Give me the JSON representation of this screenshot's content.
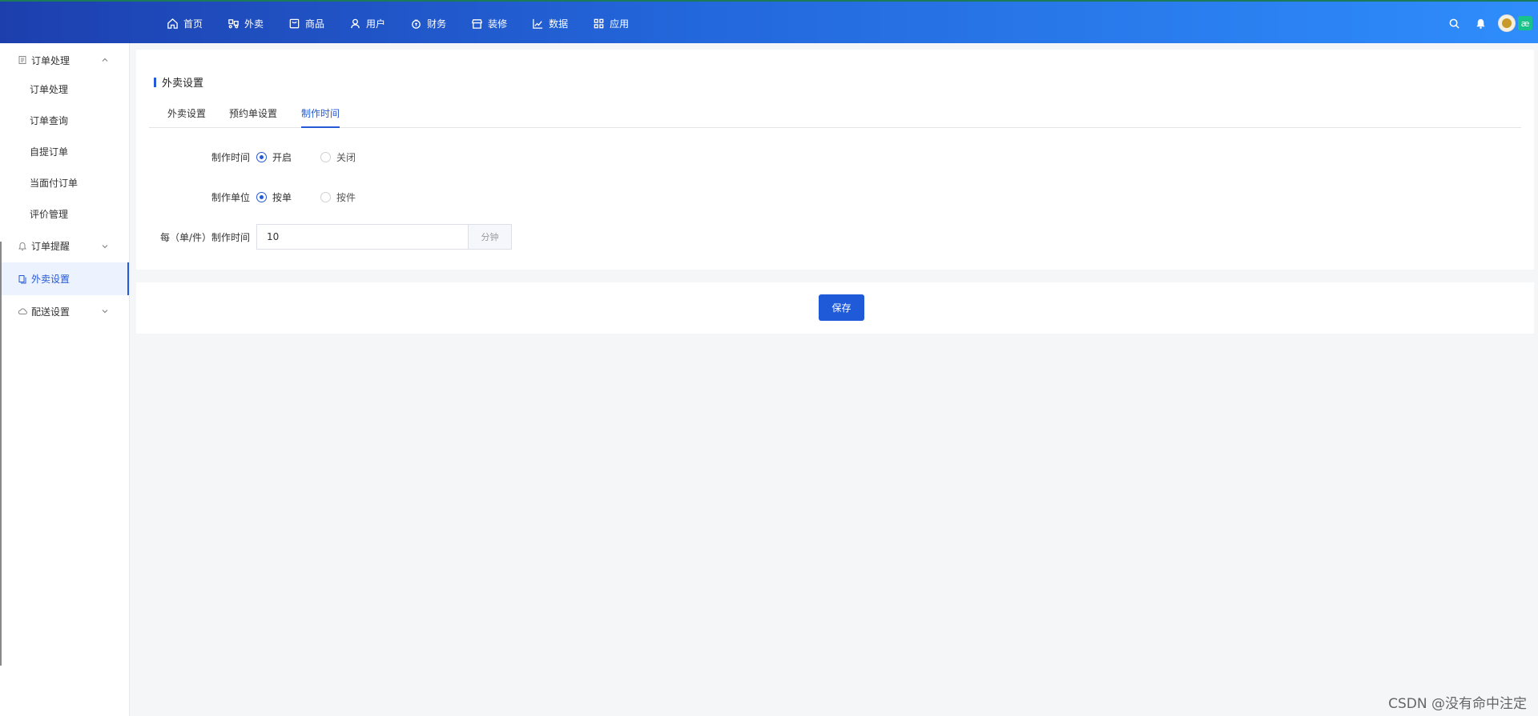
{
  "header": {
    "nav": [
      {
        "label": "首页",
        "icon": "home-icon"
      },
      {
        "label": "外卖",
        "icon": "delivery-icon"
      },
      {
        "label": "商品",
        "icon": "product-icon"
      },
      {
        "label": "用户",
        "icon": "user-icon"
      },
      {
        "label": "财务",
        "icon": "finance-icon"
      },
      {
        "label": "装修",
        "icon": "store-icon"
      },
      {
        "label": "数据",
        "icon": "chart-icon"
      },
      {
        "label": "应用",
        "icon": "apps-icon"
      }
    ],
    "brand_badge": "æ"
  },
  "sidebar": {
    "groups": [
      {
        "label": "订单处理",
        "expanded": true,
        "items": [
          "订单处理",
          "订单查询",
          "自提订单",
          "当面付订单",
          "评价管理"
        ]
      },
      {
        "label": "订单提醒",
        "expanded": false
      },
      {
        "label": "外卖设置",
        "active": true
      },
      {
        "label": "配送设置",
        "expanded": false
      }
    ]
  },
  "page": {
    "title": "外卖设置",
    "tabs": [
      {
        "label": "外卖设置",
        "active": false
      },
      {
        "label": "预约单设置",
        "active": false
      },
      {
        "label": "制作时间",
        "active": true
      }
    ],
    "form": {
      "make_time": {
        "label": "制作时间",
        "options": [
          "开启",
          "关闭"
        ],
        "selected": "开启"
      },
      "make_unit": {
        "label": "制作单位",
        "options": [
          "按单",
          "按件"
        ],
        "selected": "按单"
      },
      "per_time": {
        "label": "每（单/件）制作时间",
        "value": "10",
        "unit": "分钟"
      }
    },
    "save_label": "保存"
  },
  "watermark": "CSDN @没有命中注定",
  "colors": {
    "accent": "#2559d6",
    "header_start": "#1d3fae",
    "header_end": "#2f8dfb"
  }
}
